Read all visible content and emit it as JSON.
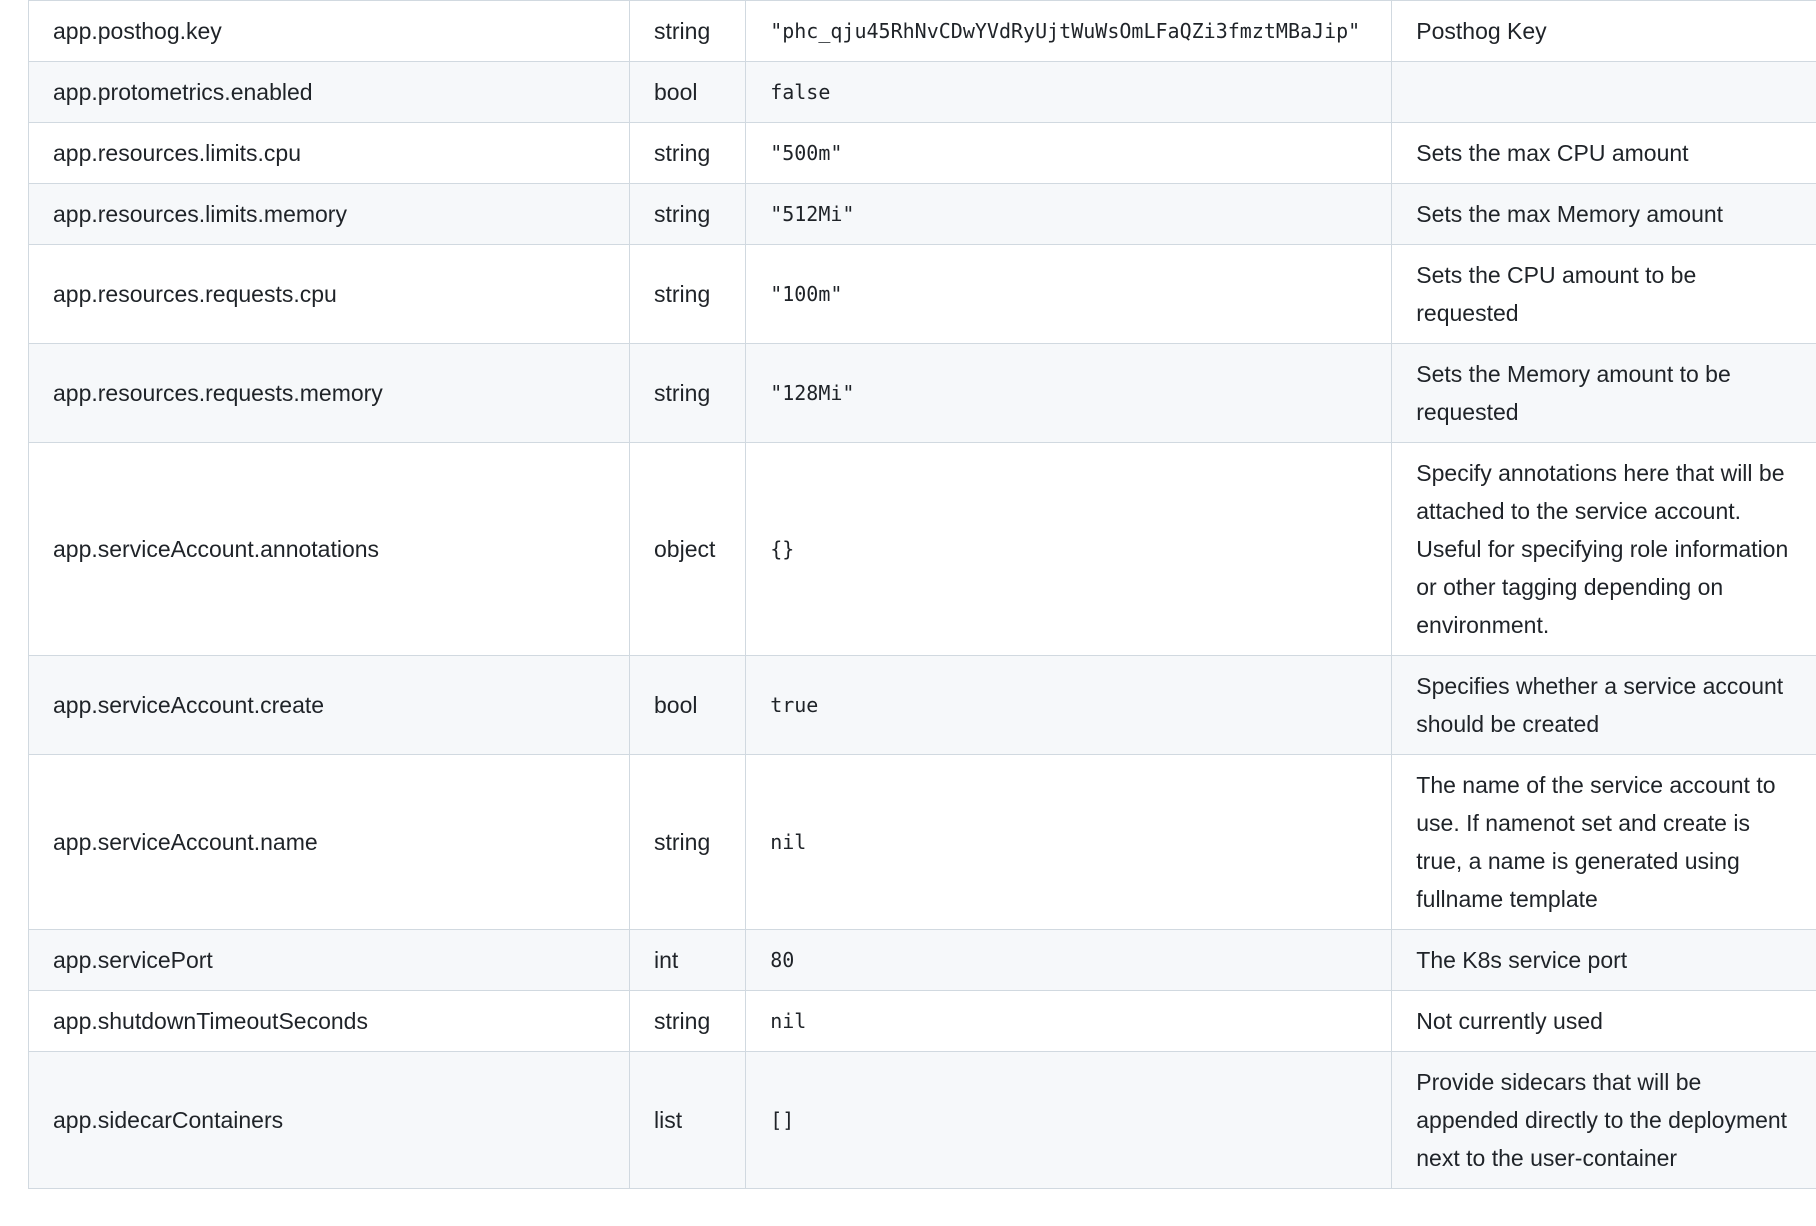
{
  "rows": [
    {
      "key": "app.posthog.key",
      "type": "string",
      "default": "\"phc_qju45RhNvCDwYVdRyUjtWuWsOmLFaQZi3fmztMBaJip\"",
      "description": "Posthog Key"
    },
    {
      "key": "app.protometrics.enabled",
      "type": "bool",
      "default": "false",
      "description": ""
    },
    {
      "key": "app.resources.limits.cpu",
      "type": "string",
      "default": "\"500m\"",
      "description": "Sets the max CPU amount"
    },
    {
      "key": "app.resources.limits.memory",
      "type": "string",
      "default": "\"512Mi\"",
      "description": "Sets the max Memory amount"
    },
    {
      "key": "app.resources.requests.cpu",
      "type": "string",
      "default": "\"100m\"",
      "description": "Sets the CPU amount to be requested"
    },
    {
      "key": "app.resources.requests.memory",
      "type": "string",
      "default": "\"128Mi\"",
      "description": "Sets the Memory amount to be requested"
    },
    {
      "key": "app.serviceAccount.annotations",
      "type": "object",
      "default": "{}",
      "description": "Specify annotations here that will be attached to the service account. Useful for specifying role information or other tagging depending on environment."
    },
    {
      "key": "app.serviceAccount.create",
      "type": "bool",
      "default": "true",
      "description": "Specifies whether a service account should be created"
    },
    {
      "key": "app.serviceAccount.name",
      "type": "string",
      "default": "nil",
      "description": "The name of the service account to use. If namenot set and create is true, a name is generated using fullname template"
    },
    {
      "key": "app.servicePort",
      "type": "int",
      "default": "80",
      "description": "The K8s service port"
    },
    {
      "key": "app.shutdownTimeoutSeconds",
      "type": "string",
      "default": "nil",
      "description": "Not currently used"
    },
    {
      "key": "app.sidecarContainers",
      "type": "list",
      "default": "[]",
      "description": "Provide sidecars that will be appended directly to the deployment next to the user-container"
    }
  ]
}
